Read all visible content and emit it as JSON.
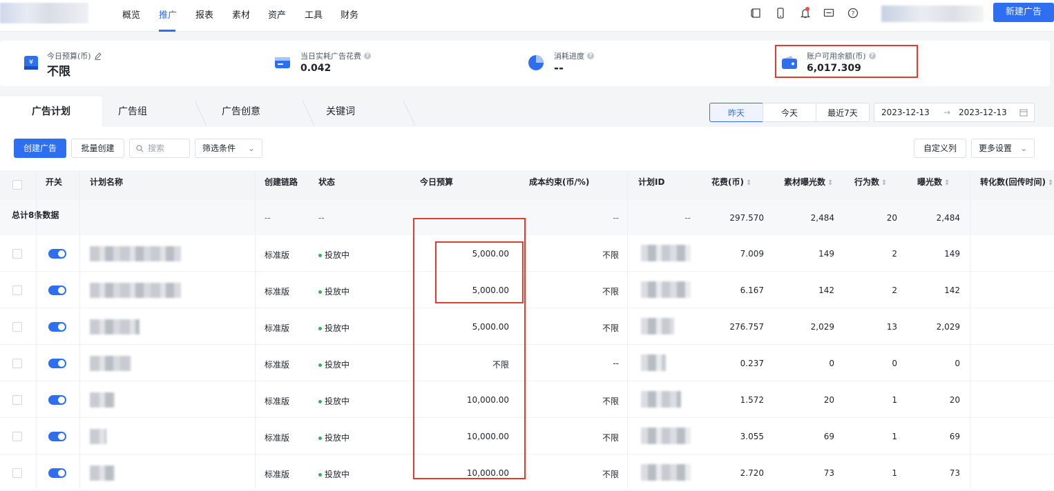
{
  "nav": {
    "items": [
      "概览",
      "推广",
      "报表",
      "素材",
      "资产",
      "工具",
      "财务"
    ],
    "active": "推广",
    "new_ad_label": "新建广告"
  },
  "stats": {
    "budget_label": "今日预算(币)",
    "budget_value": "不限",
    "spend_label": "当日实耗广告花费",
    "spend_value": "0.042",
    "progress_label": "消耗进度",
    "progress_value": "--",
    "balance_label": "账户可用余额(币)",
    "balance_value": "6,017.309"
  },
  "tabs": [
    "广告计划",
    "广告组",
    "广告创意",
    "关键词"
  ],
  "date_buttons": [
    "昨天",
    "今天",
    "最近7天"
  ],
  "date_range": {
    "start": "2023-12-13",
    "end": "2023-12-13"
  },
  "toolbar": {
    "create_label": "创建广告",
    "batch_label": "批量创建",
    "search_placeholder": "搜索",
    "filter_label": "筛选条件",
    "custom_cols_label": "自定义列",
    "more_settings_label": "更多设置"
  },
  "table": {
    "headers": {
      "switch": "开关",
      "name": "计划名称",
      "link": "创建链路",
      "status": "状态",
      "budget": "今日预算",
      "cost_limit": "成本约束(币/%)",
      "plan_id": "计划ID",
      "spend": "花费(币)",
      "material_impr": "素材曝光数",
      "actions": "行为数",
      "impressions": "曝光数",
      "conversions": "转化数(回传时间)"
    },
    "total": {
      "label": "总计8条数据",
      "link": "--",
      "status": "--",
      "cost_limit": "--",
      "plan_id": "--",
      "spend": "297.570",
      "material_impr": "2,484",
      "actions": "20",
      "impressions": "2,484"
    },
    "rows": [
      {
        "link": "标准版",
        "status": "投放中",
        "budget": "5,000.00",
        "cost_limit": "不限",
        "spend": "7.009",
        "material_impr": "149",
        "actions": "2",
        "impressions": "149"
      },
      {
        "link": "标准版",
        "status": "投放中",
        "budget": "5,000.00",
        "cost_limit": "不限",
        "spend": "6.167",
        "material_impr": "142",
        "actions": "2",
        "impressions": "142"
      },
      {
        "link": "标准版",
        "status": "投放中",
        "budget": "5,000.00",
        "cost_limit": "不限",
        "spend": "276.757",
        "material_impr": "2,029",
        "actions": "13",
        "impressions": "2,029"
      },
      {
        "link": "标准版",
        "status": "投放中",
        "budget": "不限",
        "cost_limit": "--",
        "spend": "0.237",
        "material_impr": "0",
        "actions": "0",
        "impressions": "0"
      },
      {
        "link": "标准版",
        "status": "投放中",
        "budget": "10,000.00",
        "cost_limit": "不限",
        "spend": "1.572",
        "material_impr": "20",
        "actions": "1",
        "impressions": "20"
      },
      {
        "link": "标准版",
        "status": "投放中",
        "budget": "10,000.00",
        "cost_limit": "不限",
        "spend": "3.055",
        "material_impr": "69",
        "actions": "1",
        "impressions": "69"
      },
      {
        "link": "标准版",
        "status": "投放中",
        "budget": "10,000.00",
        "cost_limit": "不限",
        "spend": "2.720",
        "material_impr": "73",
        "actions": "1",
        "impressions": "73"
      }
    ]
  },
  "colors": {
    "accent": "#2e6ff2",
    "highlight_box": "#e23b2e",
    "status_green": "#2fb45a"
  }
}
